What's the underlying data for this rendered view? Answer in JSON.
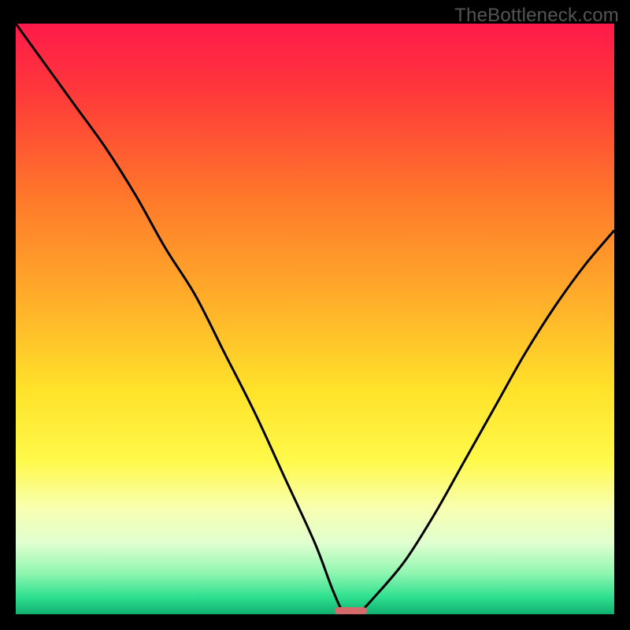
{
  "watermark": "TheBottleneck.com",
  "chart_data": {
    "type": "line",
    "title": "",
    "xlabel": "",
    "ylabel": "",
    "xlim": [
      0,
      100
    ],
    "ylim": [
      0,
      100
    ],
    "background_gradient": {
      "stops": [
        {
          "pos": 0.0,
          "color": "#ff1a4a"
        },
        {
          "pos": 0.12,
          "color": "#ff3a3a"
        },
        {
          "pos": 0.3,
          "color": "#ff7a2a"
        },
        {
          "pos": 0.48,
          "color": "#ffb22a"
        },
        {
          "pos": 0.62,
          "color": "#ffe22a"
        },
        {
          "pos": 0.74,
          "color": "#fff94a"
        },
        {
          "pos": 0.82,
          "color": "#f8ffb0"
        },
        {
          "pos": 0.88,
          "color": "#e0ffd0"
        },
        {
          "pos": 0.93,
          "color": "#90f6b0"
        },
        {
          "pos": 0.97,
          "color": "#30e090"
        },
        {
          "pos": 1.0,
          "color": "#10b070"
        }
      ]
    },
    "series": [
      {
        "name": "bottleneck-curve",
        "x": [
          0,
          5,
          10,
          15,
          20,
          25,
          30,
          35,
          40,
          45,
          50,
          53,
          55,
          57,
          60,
          65,
          70,
          75,
          80,
          85,
          90,
          95,
          100
        ],
        "y": [
          100,
          93,
          86,
          79,
          71,
          62,
          54,
          44,
          34,
          23,
          12,
          4,
          0,
          0,
          3,
          9,
          17,
          26,
          35,
          44,
          52,
          59,
          65
        ]
      }
    ],
    "marker": {
      "name": "optimal-range",
      "x_center": 56,
      "y": 0,
      "width": 5.5,
      "height": 1.2,
      "color": "#d46a6a"
    }
  }
}
